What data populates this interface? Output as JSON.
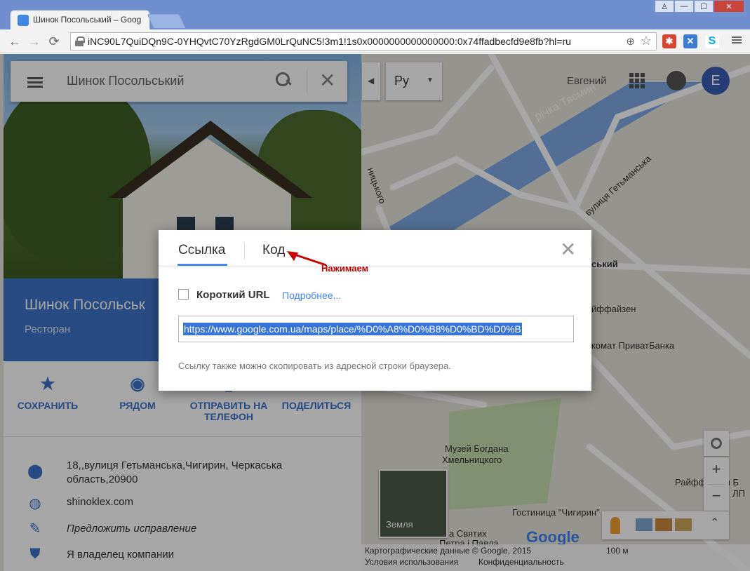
{
  "browser": {
    "tab_title": "Шинок Посольський – Goog",
    "url": "iNC90L7QuiDQn9C-0YHQvtC70YzRgdGM0LrQuNC5!3m1!1s0x0000000000000000:0x74ffadbecfd9e8fb?hl=ru",
    "window_buttons": [
      "♙",
      "—",
      "☐",
      "✕"
    ]
  },
  "panel": {
    "search_value": "Шинок Посольський",
    "place_name": "Шинок Посольськ",
    "place_type": "Ресторан",
    "actions": [
      {
        "label": "СОХРАНИТЬ",
        "icon": "star-icon"
      },
      {
        "label": "РЯДОМ",
        "icon": "location-icon"
      },
      {
        "label": "ОТПРАВИТЬ НА",
        "label2": "ТЕЛЕФОН",
        "icon": "phone-icon"
      },
      {
        "label": "ПОДЕЛИТЬСЯ",
        "icon": "share-icon"
      }
    ],
    "address_line1": "18,,вулиця Гетьманська,Чигирин, Черкаська",
    "address_line2": "область,20900",
    "website": "shinoklex.com",
    "suggest": "Предложить исправление",
    "owner": "Я владелец компании"
  },
  "topbar": {
    "language": "Ру",
    "user_name": "Евгений",
    "avatar_letter": "E"
  },
  "map": {
    "labels": {
      "river": "річка Тясмин",
      "street": "вулиця Гетьманська",
      "ntskogo": "ницького",
      "skiy": "ський",
      "raif": "йффайзен",
      "bank": "комат ПриватБанка",
      "museum1": "Музей Богдана",
      "museum2": "Хмельницкого",
      "hotel": "Гостиница \"Чигирин\"",
      "raif2": "Райффайзен Б",
      "lp": "ЛП",
      "svyatyh": "а Святих",
      "petra": "Петра і Павла"
    },
    "earth_label": "Земля",
    "google_logo": "Google",
    "scale": "100 м",
    "footer_copyright": "Картографические данные © Google, 2015",
    "footer_terms": "Условия использования",
    "footer_privacy": "Конфиденциальность"
  },
  "dialog": {
    "tab_link": "Ссылка",
    "tab_code": "Код",
    "short_url_label": "Короткий URL",
    "more_link": "Подробнее...",
    "url_value": "https://www.google.com.ua/maps/place/%D0%A8%D0%B8%D0%BD%D0%B",
    "hint": "Ссылку также можно скопировать из адресной строки браузера."
  },
  "annotation": {
    "text": "Нажимаем",
    "color": "#cc0000"
  }
}
